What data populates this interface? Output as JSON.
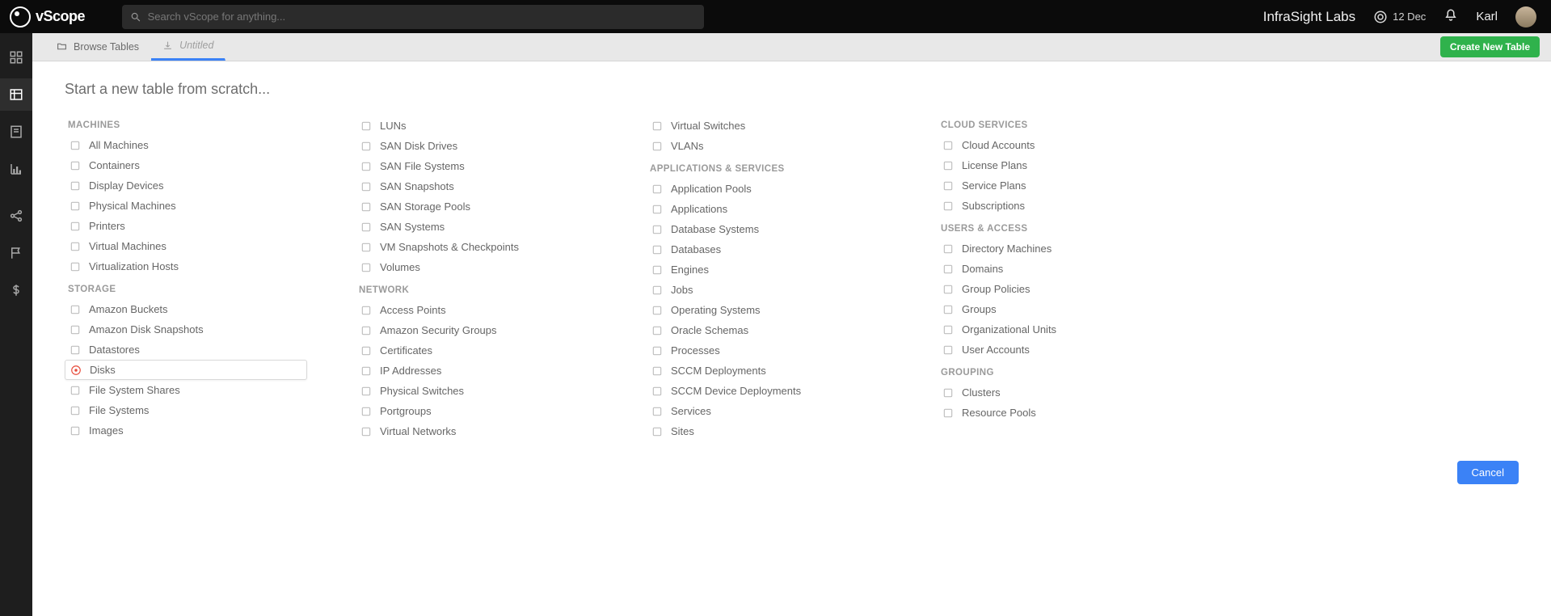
{
  "topbar": {
    "logo_text": "vScope",
    "search_placeholder": "Search vScope for anything...",
    "brand": "InfraSight Labs",
    "date": "12 Dec",
    "user": "Karl"
  },
  "tabs": {
    "browse": "Browse Tables",
    "untitled": "Untitled",
    "create": "Create New Table"
  },
  "page": {
    "title": "Start a new table from scratch...",
    "cancel": "Cancel",
    "selected": "Disks"
  },
  "columns": [
    {
      "sections": [
        {
          "title": "MACHINES",
          "items": [
            "All Machines",
            "Containers",
            "Display Devices",
            "Physical Machines",
            "Printers",
            "Virtual Machines",
            "Virtualization Hosts"
          ]
        },
        {
          "title": "STORAGE",
          "items": [
            "Amazon Buckets",
            "Amazon Disk Snapshots",
            "Datastores",
            "Disks",
            "File System Shares",
            "File Systems",
            "Images"
          ]
        }
      ]
    },
    {
      "sections": [
        {
          "title": "",
          "items": [
            "LUNs",
            "SAN Disk Drives",
            "SAN File Systems",
            "SAN Snapshots",
            "SAN Storage Pools",
            "SAN Systems",
            "VM Snapshots & Checkpoints",
            "Volumes"
          ]
        },
        {
          "title": "NETWORK",
          "items": [
            "Access Points",
            "Amazon Security Groups",
            "Certificates",
            "IP Addresses",
            "Physical Switches",
            "Portgroups",
            "Virtual Networks"
          ]
        }
      ]
    },
    {
      "sections": [
        {
          "title": "",
          "items": [
            "Virtual Switches",
            "VLANs"
          ]
        },
        {
          "title": "APPLICATIONS & SERVICES",
          "items": [
            "Application Pools",
            "Applications",
            "Database Systems",
            "Databases",
            "Engines",
            "Jobs",
            "Operating Systems",
            "Oracle Schemas",
            "Processes",
            "SCCM Deployments",
            "SCCM Device Deployments",
            "Services",
            "Sites"
          ]
        }
      ]
    },
    {
      "sections": [
        {
          "title": "CLOUD SERVICES",
          "items": [
            "Cloud Accounts",
            "License Plans",
            "Service Plans",
            "Subscriptions"
          ]
        },
        {
          "title": "USERS & ACCESS",
          "items": [
            "Directory Machines",
            "Domains",
            "Group Policies",
            "Groups",
            "Organizational Units",
            "User Accounts"
          ]
        },
        {
          "title": "GROUPING",
          "items": [
            "Clusters",
            "Resource Pools"
          ]
        }
      ]
    }
  ]
}
